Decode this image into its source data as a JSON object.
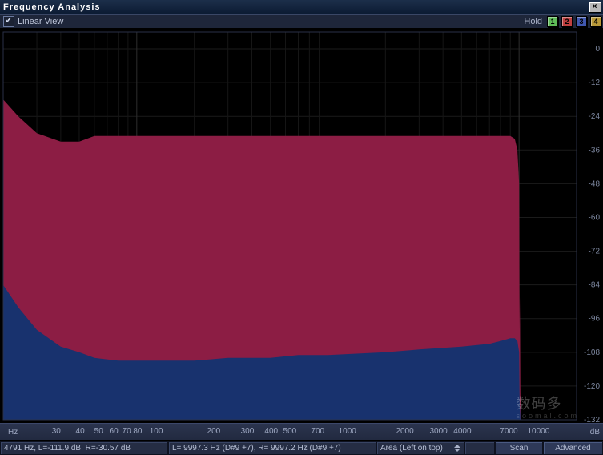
{
  "window": {
    "title": "Frequency Analysis",
    "close_icon": "×"
  },
  "toolbar": {
    "linear_view_label": "Linear View",
    "hold_label": "Hold",
    "hold_buttons": [
      "1",
      "2",
      "3",
      "4"
    ]
  },
  "status": {
    "cursor": "4791 Hz, L=-111.9 dB, R=-30.57 dB",
    "peaks": "L= 9997.3 Hz (D#9 +7), R= 9997.2 Hz (D#9 +7)",
    "area_label": "Area (Left on top)",
    "scan_label": "Scan",
    "advanced_label": "Advanced"
  },
  "watermark": {
    "main": "数码多",
    "sub": "soomal.com"
  },
  "chart_data": {
    "type": "area",
    "xscale": "log",
    "xlim": [
      20,
      20000
    ],
    "ylim": [
      -132,
      6
    ],
    "x_axis_unit": "Hz",
    "y_axis_unit": "dB",
    "x_ticks": [
      20,
      30,
      40,
      50,
      60,
      70,
      80,
      90,
      100,
      200,
      300,
      400,
      500,
      600,
      700,
      800,
      1000,
      2000,
      3000,
      4000,
      5000,
      6000,
      7000,
      8000,
      10000
    ],
    "x_tick_labels": [
      "",
      "30",
      "40",
      "50",
      "60",
      "70",
      "80",
      "",
      "100",
      "200",
      "300",
      "400",
      "500",
      "",
      "700",
      "",
      "1000",
      "2000",
      "3000",
      "4000",
      "",
      "",
      "7000",
      "",
      "10000"
    ],
    "y_ticks": [
      0,
      -12,
      -24,
      -36,
      -48,
      -60,
      -72,
      -84,
      -96,
      -108,
      -120,
      -132
    ],
    "series": [
      {
        "name": "Right",
        "color": "#8c1d44",
        "fill": true,
        "data": [
          [
            20,
            -18
          ],
          [
            24,
            -24
          ],
          [
            30,
            -30
          ],
          [
            40,
            -33
          ],
          [
            50,
            -33
          ],
          [
            60,
            -31
          ],
          [
            80,
            -31
          ],
          [
            100,
            -31
          ],
          [
            200,
            -31
          ],
          [
            300,
            -31
          ],
          [
            500,
            -31
          ],
          [
            700,
            -31
          ],
          [
            1000,
            -31
          ],
          [
            2000,
            -31
          ],
          [
            3000,
            -31
          ],
          [
            5000,
            -31
          ],
          [
            7000,
            -31
          ],
          [
            8000,
            -31
          ],
          [
            9000,
            -31
          ],
          [
            9500,
            -32
          ],
          [
            9800,
            -36
          ],
          [
            10000,
            -48
          ],
          [
            10040,
            -86
          ],
          [
            10060,
            -100
          ],
          [
            10080,
            -88
          ],
          [
            10120,
            -98
          ],
          [
            10150,
            -120
          ],
          [
            10200,
            -132
          ]
        ]
      },
      {
        "name": "Left",
        "color": "#18326e",
        "fill": true,
        "data": [
          [
            20,
            -84
          ],
          [
            24,
            -92
          ],
          [
            30,
            -100
          ],
          [
            40,
            -106
          ],
          [
            50,
            -108
          ],
          [
            60,
            -110
          ],
          [
            80,
            -111
          ],
          [
            100,
            -111
          ],
          [
            200,
            -111
          ],
          [
            300,
            -110
          ],
          [
            500,
            -110
          ],
          [
            700,
            -109
          ],
          [
            1000,
            -109
          ],
          [
            2000,
            -108
          ],
          [
            3000,
            -107
          ],
          [
            5000,
            -106
          ],
          [
            7000,
            -105
          ],
          [
            8000,
            -104
          ],
          [
            9000,
            -103
          ],
          [
            9500,
            -103
          ],
          [
            9800,
            -104
          ],
          [
            10000,
            -108
          ],
          [
            10050,
            -122
          ],
          [
            10100,
            -130
          ],
          [
            10130,
            -126
          ],
          [
            10160,
            -132
          ]
        ]
      }
    ]
  }
}
